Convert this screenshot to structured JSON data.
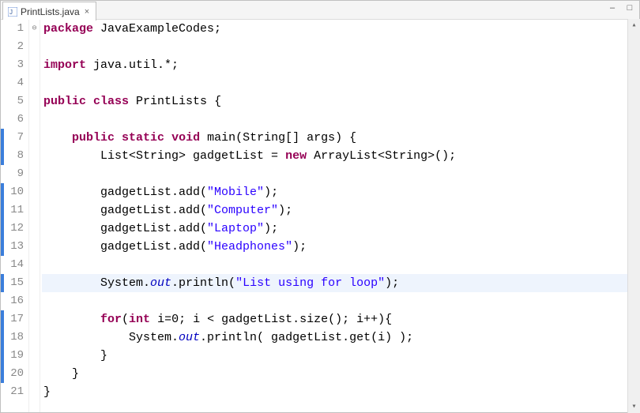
{
  "tab": {
    "label": "PrintLists.java",
    "icon": "java-file-icon"
  },
  "window_buttons": {
    "minimize": "‒",
    "maximize": "□"
  },
  "lines": [
    {
      "n": 1,
      "covered": false,
      "marker": "",
      "tokens": [
        [
          "kw",
          "package"
        ],
        [
          "plain",
          " JavaExampleCodes;"
        ]
      ]
    },
    {
      "n": 2,
      "covered": false,
      "marker": "",
      "tokens": [
        [
          "plain",
          ""
        ]
      ]
    },
    {
      "n": 3,
      "covered": false,
      "marker": "",
      "tokens": [
        [
          "kw",
          "import"
        ],
        [
          "plain",
          " java.util.*;"
        ]
      ]
    },
    {
      "n": 4,
      "covered": false,
      "marker": "",
      "tokens": [
        [
          "plain",
          ""
        ]
      ]
    },
    {
      "n": 5,
      "covered": false,
      "marker": "",
      "tokens": [
        [
          "kw",
          "public"
        ],
        [
          "plain",
          " "
        ],
        [
          "kw",
          "class"
        ],
        [
          "plain",
          " PrintLists {"
        ]
      ]
    },
    {
      "n": 6,
      "covered": false,
      "marker": "",
      "tokens": [
        [
          "plain",
          ""
        ]
      ]
    },
    {
      "n": 7,
      "covered": true,
      "marker": "⊖",
      "tokens": [
        [
          "plain",
          "    "
        ],
        [
          "kw",
          "public"
        ],
        [
          "plain",
          " "
        ],
        [
          "kw",
          "static"
        ],
        [
          "plain",
          " "
        ],
        [
          "kw",
          "void"
        ],
        [
          "plain",
          " main(String[] args) {"
        ]
      ]
    },
    {
      "n": 8,
      "covered": true,
      "marker": "",
      "tokens": [
        [
          "plain",
          "        List<String> gadgetList = "
        ],
        [
          "kw",
          "new"
        ],
        [
          "plain",
          " ArrayList<String>();"
        ]
      ]
    },
    {
      "n": 9,
      "covered": false,
      "marker": "",
      "tokens": [
        [
          "plain",
          ""
        ]
      ]
    },
    {
      "n": 10,
      "covered": true,
      "marker": "",
      "tokens": [
        [
          "plain",
          "        gadgetList.add("
        ],
        [
          "str",
          "\"Mobile\""
        ],
        [
          "plain",
          ");"
        ]
      ]
    },
    {
      "n": 11,
      "covered": true,
      "marker": "",
      "tokens": [
        [
          "plain",
          "        gadgetList.add("
        ],
        [
          "str",
          "\"Computer\""
        ],
        [
          "plain",
          ");"
        ]
      ]
    },
    {
      "n": 12,
      "covered": true,
      "marker": "",
      "tokens": [
        [
          "plain",
          "        gadgetList.add("
        ],
        [
          "str",
          "\"Laptop\""
        ],
        [
          "plain",
          ");"
        ]
      ]
    },
    {
      "n": 13,
      "covered": true,
      "marker": "",
      "tokens": [
        [
          "plain",
          "        gadgetList.add("
        ],
        [
          "str",
          "\"Headphones\""
        ],
        [
          "plain",
          ");"
        ]
      ]
    },
    {
      "n": 14,
      "covered": false,
      "marker": "",
      "tokens": [
        [
          "plain",
          ""
        ]
      ]
    },
    {
      "n": 15,
      "covered": true,
      "marker": "",
      "hl": true,
      "tokens": [
        [
          "plain",
          "        System."
        ],
        [
          "fld",
          "out"
        ],
        [
          "plain",
          ".println("
        ],
        [
          "str",
          "\"List using for loop\""
        ],
        [
          "plain",
          ");"
        ]
      ]
    },
    {
      "n": 16,
      "covered": false,
      "marker": "",
      "tokens": [
        [
          "plain",
          ""
        ]
      ]
    },
    {
      "n": 17,
      "covered": true,
      "marker": "",
      "tokens": [
        [
          "plain",
          "        "
        ],
        [
          "kw",
          "for"
        ],
        [
          "plain",
          "("
        ],
        [
          "kw",
          "int"
        ],
        [
          "plain",
          " i=0; i < gadgetList.size(); i++){"
        ]
      ]
    },
    {
      "n": 18,
      "covered": true,
      "marker": "",
      "tokens": [
        [
          "plain",
          "            System."
        ],
        [
          "fld",
          "out"
        ],
        [
          "plain",
          ".println( gadgetList.get(i) );"
        ]
      ]
    },
    {
      "n": 19,
      "covered": true,
      "marker": "",
      "tokens": [
        [
          "plain",
          "        }"
        ]
      ]
    },
    {
      "n": 20,
      "covered": true,
      "marker": "",
      "tokens": [
        [
          "plain",
          "    }"
        ]
      ]
    },
    {
      "n": 21,
      "covered": false,
      "marker": "",
      "tokens": [
        [
          "plain",
          "}"
        ]
      ]
    }
  ]
}
